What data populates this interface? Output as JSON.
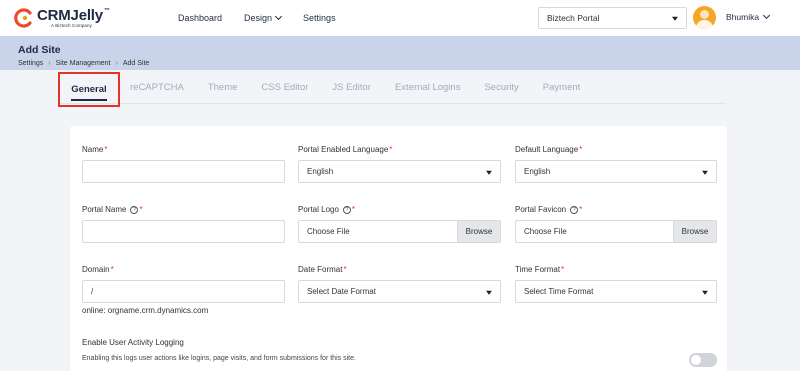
{
  "app": {
    "brand": "CRMJelly",
    "tagline": "A Biztech Company"
  },
  "nav": {
    "dashboard": "Dashboard",
    "design": "Design",
    "settings": "Settings"
  },
  "portal_select": {
    "value": "Biztech Portal"
  },
  "user": {
    "name": "Bhumika"
  },
  "page": {
    "title": "Add Site",
    "breadcrumb": [
      "Settings",
      "Site Management",
      "Add Site"
    ]
  },
  "tabs": [
    {
      "label": "General",
      "active": true
    },
    {
      "label": "reCAPTCHA"
    },
    {
      "label": "Theme"
    },
    {
      "label": "CSS Editor"
    },
    {
      "label": "JS Editor"
    },
    {
      "label": "External Logins"
    },
    {
      "label": "Security"
    },
    {
      "label": "Payment"
    }
  ],
  "form": {
    "name": {
      "label": "Name",
      "value": ""
    },
    "portal_enabled_language": {
      "label": "Portal Enabled Language",
      "value": "English"
    },
    "default_language": {
      "label": "Default Language",
      "value": "English"
    },
    "portal_name": {
      "label": "Portal Name",
      "value": ""
    },
    "portal_logo": {
      "label": "Portal Logo",
      "value": "Choose File",
      "button": "Browse"
    },
    "portal_favicon": {
      "label": "Portal Favicon",
      "value": "Choose File",
      "button": "Browse"
    },
    "domain": {
      "label": "Domain",
      "value": "/",
      "hint": "online: orgname.crm.dynamics.com"
    },
    "date_format": {
      "label": "Date Format",
      "value": "Select Date Format"
    },
    "time_format": {
      "label": "Time Format",
      "value": "Select Time Format"
    },
    "activity_logging": {
      "title": "Enable User Activity Logging",
      "description": "Enabling this logs user actions like logins, page visits, and form submissions for this site.",
      "enabled": false
    }
  },
  "colors": {
    "accent": "#1f2a44",
    "highlight_border": "#e0352b",
    "header_band": "#c9d3ea",
    "required": "#e0352b"
  }
}
